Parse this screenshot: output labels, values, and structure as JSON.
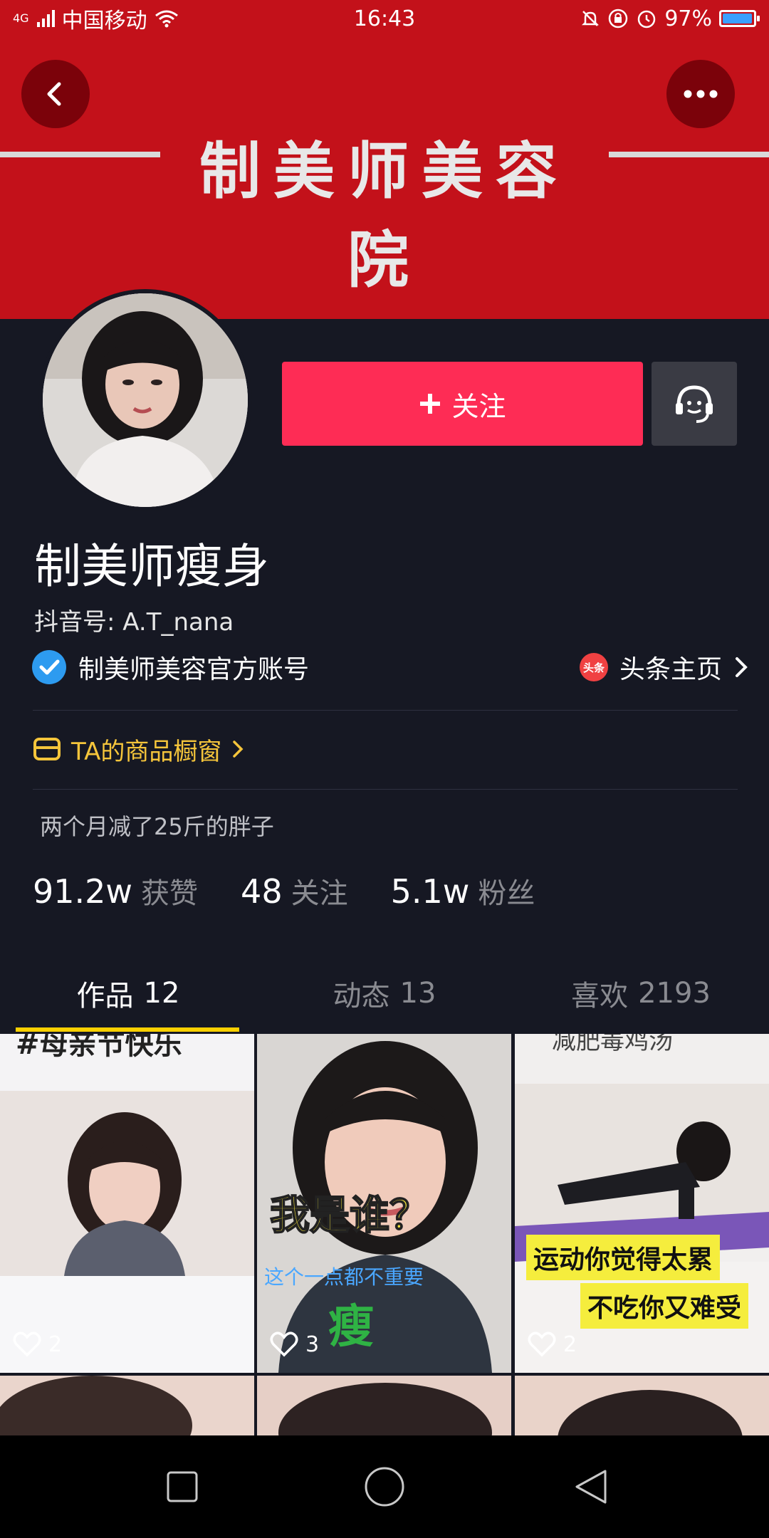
{
  "status_bar": {
    "carrier": "中国移动",
    "network": "4G",
    "time": "16:43",
    "battery": "97%",
    "battery_level": 0.97
  },
  "banner": {
    "title": "制美师美容院",
    "color": "#c3111a"
  },
  "header": {
    "back_icon": "chevron-left-icon",
    "more_icon": "more-horizontal-icon"
  },
  "profile": {
    "follow_label": "关注",
    "nickname": "制美师瘦身",
    "douyin_id": "抖音号: A.T_nana",
    "verified_text": "制美师美容官方账号",
    "toutiao_badge": "头条",
    "toutiao_label": "头条主页",
    "shop_label": "TA的商品橱窗",
    "bio": "两个月减了25斤的胖子"
  },
  "stats": [
    {
      "value": "91.2w",
      "label": "获赞"
    },
    {
      "value": "48",
      "label": "关注"
    },
    {
      "value": "5.1w",
      "label": "粉丝"
    }
  ],
  "tabs": [
    {
      "label": "作品",
      "count": "12"
    },
    {
      "label": "动态",
      "count": "13"
    },
    {
      "label": "喜欢",
      "count": "2193"
    }
  ],
  "videos": [
    {
      "likes": "2",
      "caption": "#母亲节快乐"
    },
    {
      "likes": "3",
      "caption": "我是谁？",
      "sub": "这个一点都不重要",
      "tag": "瘦"
    },
    {
      "likes": "2",
      "caption": "减肥毒鸡汤",
      "line1": "运动你觉得太累",
      "line2": "不吃你又难受"
    }
  ],
  "colors": {
    "accent": "#fe2c55",
    "background": "#161823",
    "shop": "#f5c53b",
    "tab_indicator": "#fbd000",
    "verified": "#2d9bf0"
  }
}
